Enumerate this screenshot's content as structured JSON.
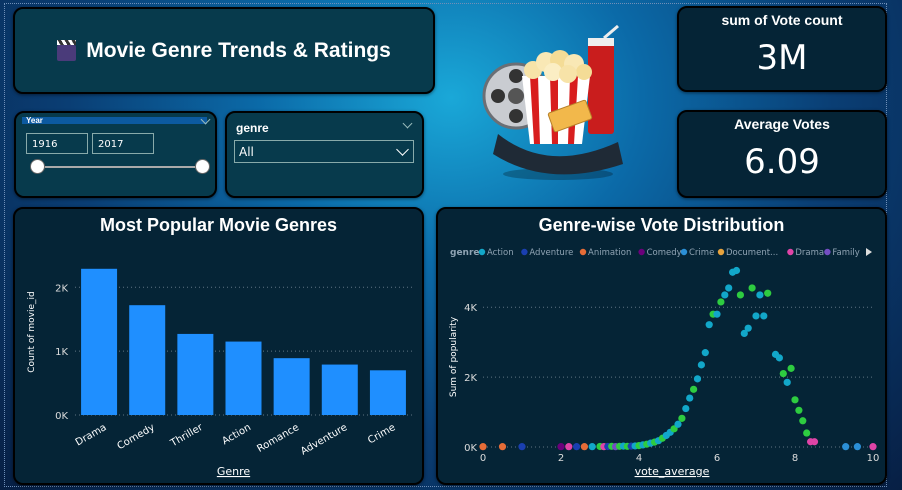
{
  "header": {
    "title": "Movie Genre Trends & Ratings"
  },
  "kpis": [
    {
      "label": "sum of Vote count",
      "value": "3M"
    },
    {
      "label": "Average Votes",
      "value": "6.09"
    }
  ],
  "year_slicer": {
    "label": "Year",
    "start": "1916",
    "end": "2017"
  },
  "genre_slicer": {
    "label": "genre",
    "selected": "All"
  },
  "colors": {
    "bar": "#1f8fff",
    "card": "#052436",
    "accent": "#12a7c9"
  },
  "chart_data": [
    {
      "type": "bar",
      "title": "Most Popular Movie Genres",
      "xlabel": "Genre",
      "ylabel": "Count of movie_id",
      "categories": [
        "Drama",
        "Comedy",
        "Thriller",
        "Action",
        "Romance",
        "Adventure",
        "Crime"
      ],
      "values": [
        2290,
        1720,
        1270,
        1150,
        890,
        790,
        700
      ],
      "yticks": [
        {
          "v": 0,
          "label": "0K"
        },
        {
          "v": 1000,
          "label": "1K"
        },
        {
          "v": 2000,
          "label": "2K"
        }
      ],
      "ylim": [
        0,
        2600
      ],
      "grid": true
    },
    {
      "type": "scatter",
      "title": "Genre-wise Vote Distribution",
      "xlabel": "vote_average",
      "ylabel": "Sum of popularity",
      "legend_title": "genre",
      "legend": [
        {
          "name": "Action",
          "color": "#12a7c9"
        },
        {
          "name": "Adventure",
          "color": "#1a3fb0"
        },
        {
          "name": "Animation",
          "color": "#e66c37"
        },
        {
          "name": "Comedy",
          "color": "#6b007b"
        },
        {
          "name": "Crime",
          "color": "#2b8fd6"
        },
        {
          "name": "Document...",
          "color": "#e8a33d"
        },
        {
          "name": "Drama",
          "color": "#e044a7"
        },
        {
          "name": "Family",
          "color": "#744ec2"
        }
      ],
      "xticks": [
        0,
        2,
        4,
        6,
        8,
        10
      ],
      "yticks": [
        {
          "v": 0,
          "label": "0K"
        },
        {
          "v": 2000,
          "label": "2K"
        },
        {
          "v": 4000,
          "label": "4K"
        }
      ],
      "xlim": [
        0,
        10
      ],
      "ylim": [
        0,
        5150
      ],
      "grid": true,
      "points": [
        {
          "x": 0,
          "y": 10,
          "c": "#e66c37"
        },
        {
          "x": 0.5,
          "y": 10,
          "c": "#e66c37"
        },
        {
          "x": 1,
          "y": 10,
          "c": "#1a3fb0"
        },
        {
          "x": 2,
          "y": 10,
          "c": "#6b007b"
        },
        {
          "x": 2.2,
          "y": 10,
          "c": "#e044a7"
        },
        {
          "x": 2.4,
          "y": 10,
          "c": "#1a3fb0"
        },
        {
          "x": 2.6,
          "y": 10,
          "c": "#e66c37"
        },
        {
          "x": 2.8,
          "y": 10,
          "c": "#12a7c9"
        },
        {
          "x": 3.0,
          "y": 15,
          "c": "#2ecc40"
        },
        {
          "x": 3.1,
          "y": 10,
          "c": "#e044a7"
        },
        {
          "x": 3.2,
          "y": 15,
          "c": "#1a3fb0"
        },
        {
          "x": 3.3,
          "y": 20,
          "c": "#2ecc40"
        },
        {
          "x": 3.4,
          "y": 10,
          "c": "#744ec2"
        },
        {
          "x": 3.5,
          "y": 20,
          "c": "#2ecc40"
        },
        {
          "x": 3.6,
          "y": 25,
          "c": "#12a7c9"
        },
        {
          "x": 3.7,
          "y": 20,
          "c": "#2ecc40"
        },
        {
          "x": 3.8,
          "y": 25,
          "c": "#1a3fb0"
        },
        {
          "x": 3.9,
          "y": 30,
          "c": "#12a7c9"
        },
        {
          "x": 4.0,
          "y": 40,
          "c": "#2ecc40"
        },
        {
          "x": 4.1,
          "y": 60,
          "c": "#12a7c9"
        },
        {
          "x": 4.2,
          "y": 80,
          "c": "#2ecc40"
        },
        {
          "x": 4.3,
          "y": 110,
          "c": "#12a7c9"
        },
        {
          "x": 4.4,
          "y": 140,
          "c": "#2ecc40"
        },
        {
          "x": 4.5,
          "y": 180,
          "c": "#12a7c9"
        },
        {
          "x": 4.6,
          "y": 250,
          "c": "#2ecc40"
        },
        {
          "x": 4.7,
          "y": 330,
          "c": "#12a7c9"
        },
        {
          "x": 4.8,
          "y": 420,
          "c": "#12a7c9"
        },
        {
          "x": 4.9,
          "y": 520,
          "c": "#2ecc40"
        },
        {
          "x": 5.0,
          "y": 650,
          "c": "#12a7c9"
        },
        {
          "x": 5.1,
          "y": 820,
          "c": "#2ecc40"
        },
        {
          "x": 5.2,
          "y": 1100,
          "c": "#12a7c9"
        },
        {
          "x": 5.3,
          "y": 1400,
          "c": "#12a7c9"
        },
        {
          "x": 5.4,
          "y": 1650,
          "c": "#2ecc40"
        },
        {
          "x": 5.5,
          "y": 1950,
          "c": "#12a7c9"
        },
        {
          "x": 5.6,
          "y": 2350,
          "c": "#12a7c9"
        },
        {
          "x": 5.7,
          "y": 2700,
          "c": "#12a7c9"
        },
        {
          "x": 5.8,
          "y": 3500,
          "c": "#12a7c9"
        },
        {
          "x": 5.9,
          "y": 3800,
          "c": "#2ecc40"
        },
        {
          "x": 6.0,
          "y": 3800,
          "c": "#12a7c9"
        },
        {
          "x": 6.1,
          "y": 4150,
          "c": "#2ecc40"
        },
        {
          "x": 6.2,
          "y": 4350,
          "c": "#12a7c9"
        },
        {
          "x": 6.3,
          "y": 4550,
          "c": "#12a7c9"
        },
        {
          "x": 6.4,
          "y": 5000,
          "c": "#12a7c9"
        },
        {
          "x": 6.5,
          "y": 5050,
          "c": "#12a7c9"
        },
        {
          "x": 6.6,
          "y": 4350,
          "c": "#2ecc40"
        },
        {
          "x": 6.7,
          "y": 3250,
          "c": "#12a7c9"
        },
        {
          "x": 6.8,
          "y": 3400,
          "c": "#12a7c9"
        },
        {
          "x": 6.9,
          "y": 4550,
          "c": "#2ecc40"
        },
        {
          "x": 7.0,
          "y": 3750,
          "c": "#12a7c9"
        },
        {
          "x": 7.1,
          "y": 4350,
          "c": "#12a7c9"
        },
        {
          "x": 7.2,
          "y": 3750,
          "c": "#12a7c9"
        },
        {
          "x": 7.3,
          "y": 4400,
          "c": "#2ecc40"
        },
        {
          "x": 7.5,
          "y": 2650,
          "c": "#12a7c9"
        },
        {
          "x": 7.6,
          "y": 2550,
          "c": "#12a7c9"
        },
        {
          "x": 7.7,
          "y": 2100,
          "c": "#2ecc40"
        },
        {
          "x": 7.8,
          "y": 1850,
          "c": "#12a7c9"
        },
        {
          "x": 7.9,
          "y": 2250,
          "c": "#2ecc40"
        },
        {
          "x": 8.0,
          "y": 1350,
          "c": "#2ecc40"
        },
        {
          "x": 8.1,
          "y": 1050,
          "c": "#2ecc40"
        },
        {
          "x": 8.2,
          "y": 750,
          "c": "#2ecc40"
        },
        {
          "x": 8.3,
          "y": 400,
          "c": "#2ecc40"
        },
        {
          "x": 8.4,
          "y": 150,
          "c": "#e044a7"
        },
        {
          "x": 8.5,
          "y": 150,
          "c": "#e044a7"
        },
        {
          "x": 9.3,
          "y": 10,
          "c": "#2b8fd6"
        },
        {
          "x": 9.6,
          "y": 10,
          "c": "#2b8fd6"
        },
        {
          "x": 10,
          "y": 10,
          "c": "#e044a7"
        }
      ]
    }
  ]
}
